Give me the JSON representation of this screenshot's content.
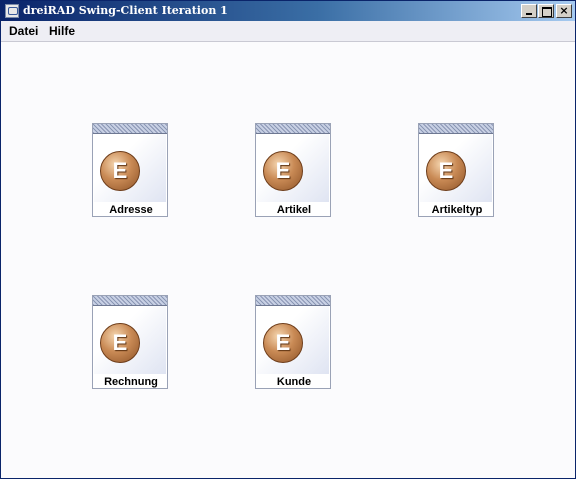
{
  "window": {
    "title": "dreiRAD Swing-Client Iteration 1",
    "buttons": {
      "minimize": "_",
      "maximize": "□",
      "close": "×"
    }
  },
  "menu": {
    "items": [
      "Datei",
      "Hilfe"
    ]
  },
  "entities": [
    {
      "label": "Adresse",
      "icon": "entity-e-icon",
      "letter": "E"
    },
    {
      "label": "Artikel",
      "icon": "entity-e-icon",
      "letter": "E"
    },
    {
      "label": "Artikeltyp",
      "icon": "entity-e-icon",
      "letter": "E"
    },
    {
      "label": "Rechnung",
      "icon": "entity-e-icon",
      "letter": "E"
    },
    {
      "label": "Kunde",
      "icon": "entity-e-icon",
      "letter": "E"
    }
  ],
  "colors": {
    "titlebar_start": "#0a246a",
    "titlebar_end": "#a6caf0",
    "icon_bronze": "#c98a55",
    "desktop_bg": "#fbfbfd"
  }
}
